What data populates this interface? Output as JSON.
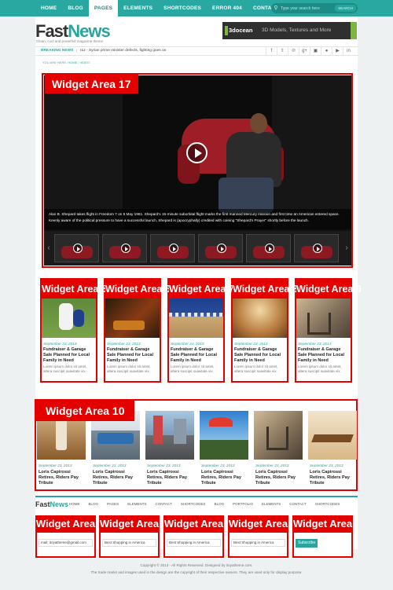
{
  "topnav": {
    "items": [
      "HOME",
      "BLOG",
      "PAGES",
      "ELEMENTS",
      "SHORTCODES",
      "ERROR 404",
      "CONTACT"
    ],
    "active": "PAGES"
  },
  "search": {
    "placeholder": "Type your search here",
    "button": "SEARCH"
  },
  "brand": {
    "name_a": "Fast",
    "name_b": "News",
    "tagline": "Clean, cool  and  powerfull  magazine theme"
  },
  "banner": {
    "logo": "3docean",
    "text": "3D Models, Textures and More"
  },
  "breaking": {
    "label": "BREAKING NEWS",
    "text": "I12 - Syrian prime minister defects, fighting goes on"
  },
  "social": [
    "f",
    "t",
    "p",
    "g+",
    "in",
    "rss",
    "yt",
    "in"
  ],
  "breadcrumb": {
    "prefix": "YOU ARE HERE:",
    "home": "HOME",
    "sep": "/",
    "current": "VIDEO"
  },
  "video": {
    "widget": "Widget Area 17",
    "caption": "Alan B. Shepard takes flight in Freedom 7 on 5 May 1961. Shepard's 15-minute suborbital flight marks the first manned Mercury mission and first time an American entered space. Keenly aware of the political pressure to have a successful launch, Shepard is (apocryphally) credited with coining \"Shepard's Prayer\" shortly before the launch.",
    "prev_icon": "chevron-left-icon",
    "next_icon": "chevron-right-icon"
  },
  "cards": [
    {
      "widget": "Widget Area 5",
      "date": "September 23, 2013",
      "title": "Fundraiser & Garage Sale Planned for Local Family in Need",
      "excerpt": "Lorem ipsum dolor sit amet, altera suscipit suavitate vix."
    },
    {
      "widget": "Widget Area 6",
      "date": "September 23, 2013",
      "title": "Fundraiser & Garage Sale Planned for Local Family in Need",
      "excerpt": "Lorem ipsum dolor sit amet, altera suscipit suavitate vix."
    },
    {
      "widget": "Widget Area 7",
      "date": "September 23, 2013",
      "title": "Fundraiser & Garage Sale Planned for Local Family in Need",
      "excerpt": "Lorem ipsum dolor sit amet, altera suscipit suavitate vix."
    },
    {
      "widget": "Widget Area 8",
      "date": "September 23, 2013",
      "title": "Fundraiser & Garage Sale Planned for Local Family in Need",
      "excerpt": "Lorem ipsum dolor sit amet, altera suscipit suavitate vix."
    },
    {
      "widget": "Widget Area 9",
      "date": "September 23, 2013",
      "title": "Fundraiser & Garage Sale Planned for Local Family in Need",
      "excerpt": "Lorem ipsum dolor sit amet, altera suscipit suavitate vix."
    }
  ],
  "widget10": {
    "widget": "Widget Area 10",
    "items": [
      {
        "date": "September 23, 2013",
        "title": "Loris Capirossi Retires, Riders Pay Tribute"
      },
      {
        "date": "September 23, 2013",
        "title": "Loris Capirossi Retires, Riders Pay Tribute"
      },
      {
        "date": "September 23, 2013",
        "title": "Loris Capirossi Retires, Riders Pay Tribute"
      },
      {
        "date": "September 23, 2013",
        "title": "Loris Capirossi Retires, Riders Pay Tribute"
      },
      {
        "date": "September 23, 2013",
        "title": "Loris Capirossi Retires, Riders Pay Tribute"
      },
      {
        "date": "September 23, 2013",
        "title": "Loris Capirossi Retires, Riders Pay Tribute"
      }
    ]
  },
  "footer_nav": [
    "HOME",
    "BLOG",
    "PAGES",
    "ELEMENTS",
    "CONTACT",
    "SHORTCODES",
    "BLOG",
    "PORTFOLIO",
    "ELEMENTS",
    "CONTACT",
    "SHORTCODES"
  ],
  "footer_widgets": [
    {
      "widget": "Widget Area 11",
      "field": "mail: itoyatheme@gmail.com"
    },
    {
      "widget": "Widget Area 12",
      "field": "Best Shopping in America"
    },
    {
      "widget": "Widget Area 13",
      "field": "Best Shopping in America"
    },
    {
      "widget": "Widget Area 14",
      "field": "Best Shopping in America"
    },
    {
      "widget": "Widget Area 15",
      "button": "Subscribe"
    }
  ],
  "copyright": {
    "line1": "Copyright © 2013 - All Rights Reserved. Designed by itoyatheme.com.",
    "line2": "The trade marks and images used in the design are the copyright of their respective owners. They are used only for display purpose."
  }
}
